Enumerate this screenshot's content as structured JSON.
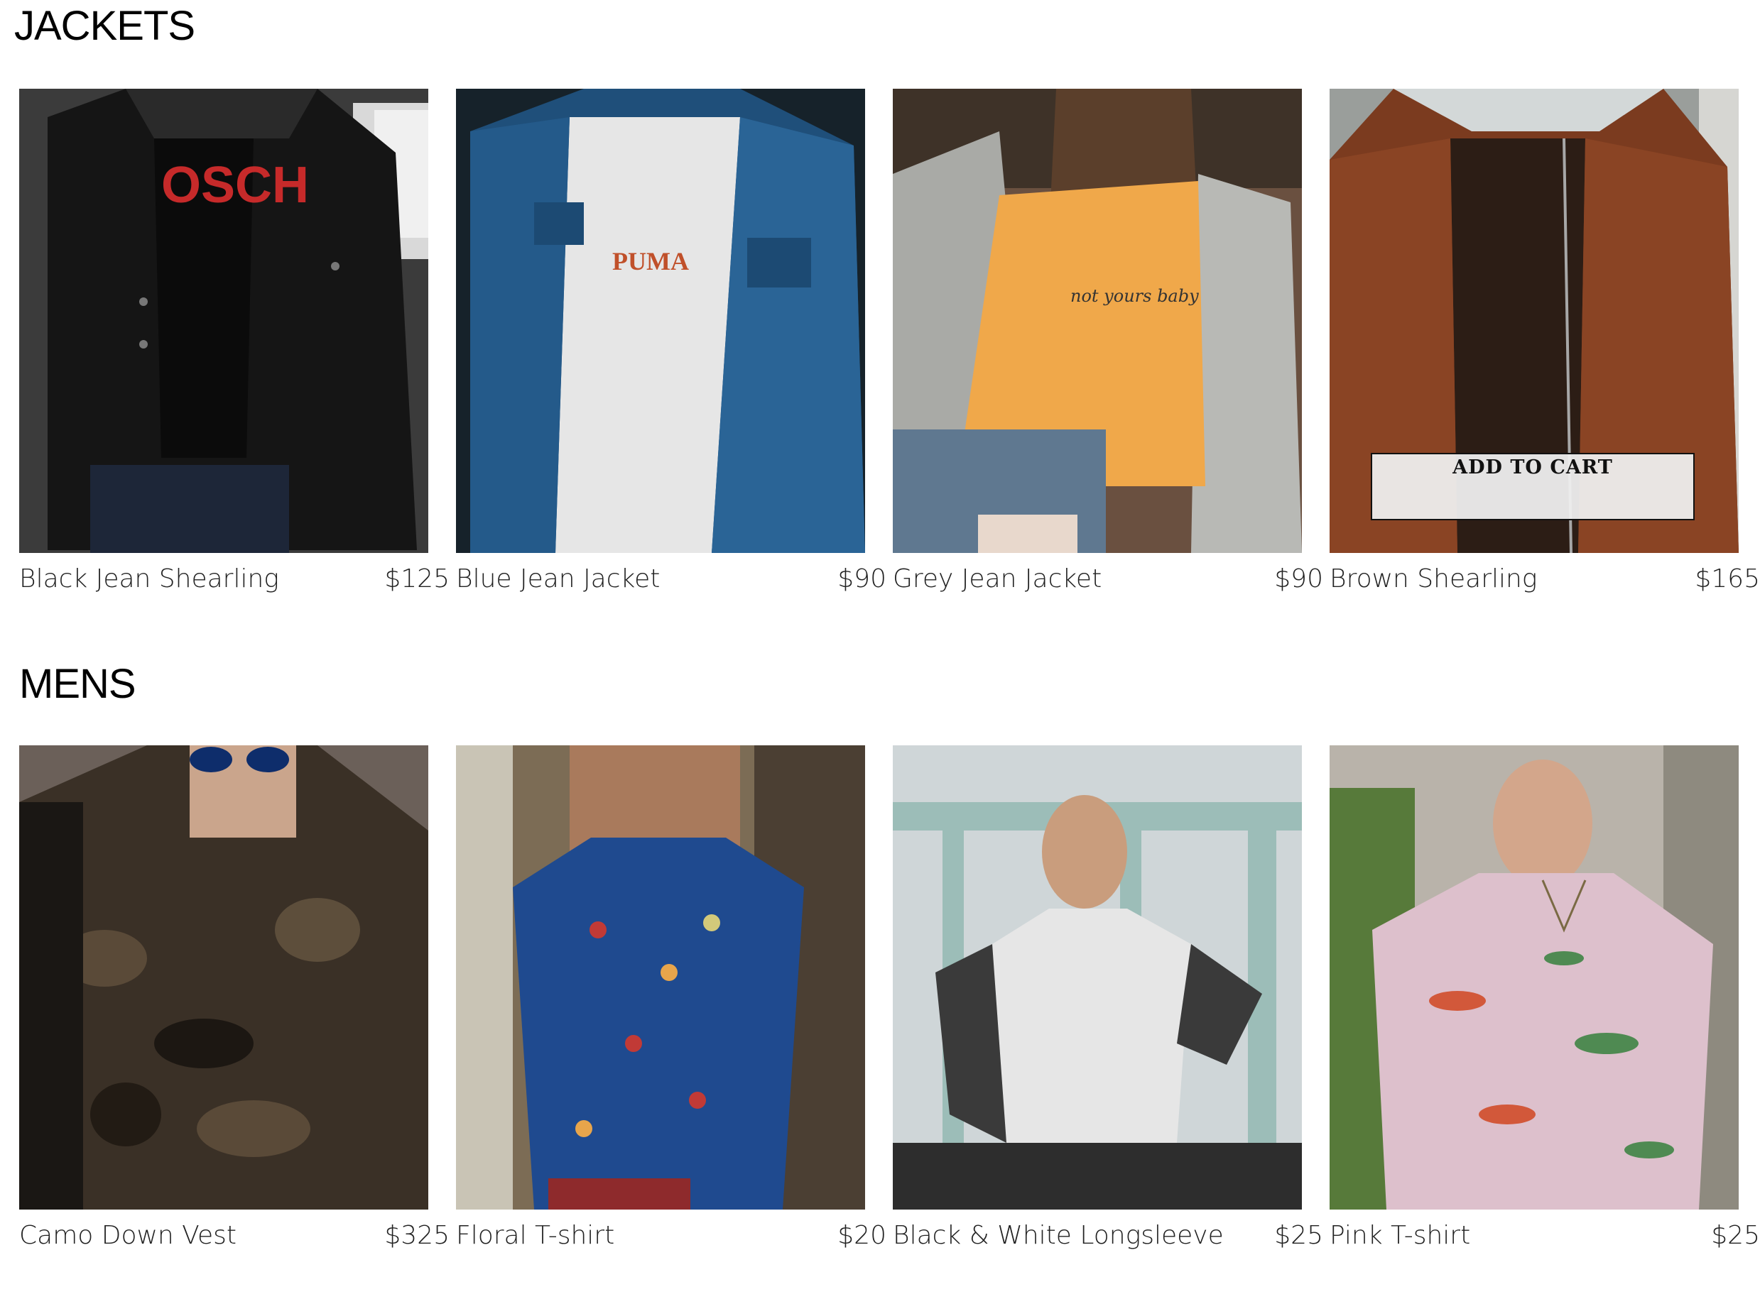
{
  "sections": [
    {
      "title": "JACKETS",
      "products": [
        {
          "name": "Black Jean Shearling",
          "price": "$125"
        },
        {
          "name": "Blue Jean Jacket",
          "price": "$90"
        },
        {
          "name": "Grey Jean Jacket",
          "price": "$90"
        },
        {
          "name": "Brown Shearling",
          "price": "$165",
          "hover_button": "ADD TO CART"
        }
      ]
    },
    {
      "title": "MENS",
      "products": [
        {
          "name": "Camo Down Vest",
          "price": "$325"
        },
        {
          "name": "Floral T-shirt",
          "price": "$20"
        },
        {
          "name": "Black & White Longsleeve",
          "price": "$25"
        },
        {
          "name": "Pink T-shirt",
          "price": "$25"
        }
      ]
    }
  ],
  "colors": {
    "background": "#ffffff",
    "text": "#222222",
    "button_bg": "#eeeeee",
    "button_border": "#111111"
  }
}
